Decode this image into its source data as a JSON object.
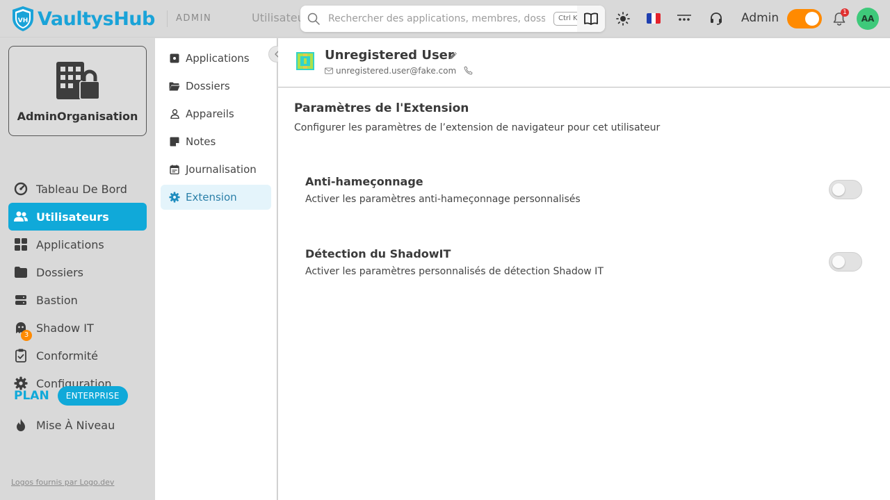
{
  "app": {
    "name": "VaultysHub",
    "shield_text": "VH",
    "brand_color": "#1aa3d8"
  },
  "header": {
    "admin_tag": "ADMIN",
    "breadcrumb": "Utilisateurs",
    "search": {
      "placeholder": "Rechercher des applications, membres, dossiers...",
      "value": "",
      "shortcut": "Ctrl K"
    },
    "language_flag": "fr",
    "user_label": "Admin",
    "admin_mode_on": true,
    "notifications_count": "1",
    "avatar_initials": "AA"
  },
  "sidebar": {
    "org_name": "AdminOrganisation",
    "items": [
      {
        "label": "Tableau De Bord",
        "icon": "gauge-icon"
      },
      {
        "label": "Utilisateurs",
        "icon": "users-icon",
        "active": true
      },
      {
        "label": "Applications",
        "icon": "grid-icon"
      },
      {
        "label": "Dossiers",
        "icon": "folder-icon"
      },
      {
        "label": "Bastion",
        "icon": "server-icon"
      },
      {
        "label": "Shadow IT",
        "icon": "ghost-icon",
        "badge": "3"
      },
      {
        "label": "Conformité",
        "icon": "clipboard-check-icon"
      },
      {
        "label": "Configuration",
        "icon": "gear-icon"
      }
    ],
    "plan_label": "PLAN",
    "plan_badge": "ENTERPRISE",
    "upgrade_label": "Mise À Niveau",
    "footer": "Logos fournis par Logo.dev"
  },
  "subnav": {
    "items": [
      {
        "label": "Applications",
        "icon": "app-square-icon"
      },
      {
        "label": "Dossiers",
        "icon": "folder-open-icon"
      },
      {
        "label": "Appareils",
        "icon": "person-icon"
      },
      {
        "label": "Notes",
        "icon": "note-icon"
      },
      {
        "label": "Journalisation",
        "icon": "calendar-icon"
      },
      {
        "label": "Extension",
        "icon": "gear-icon",
        "active": true
      }
    ]
  },
  "user": {
    "name": "Unregistered User",
    "email": "unregistered.user@fake.com"
  },
  "extension": {
    "title": "Paramètres de l'Extension",
    "description": "Configurer les paramètres de l’extension de navigateur pour cet utilisateur",
    "settings": [
      {
        "title": "Anti-hameçonnage",
        "description": "Activer les paramètres anti-hameçonnage personnalisés",
        "enabled": false
      },
      {
        "title": "Détection du ShadowIT",
        "description": "Activer les paramètres personnalisés de détection Shadow IT",
        "enabled": false
      }
    ]
  },
  "colors": {
    "accent": "#10a9d9",
    "orange": "#ff8a00",
    "alert": "#e03030",
    "avatar": "#3ec97a"
  }
}
